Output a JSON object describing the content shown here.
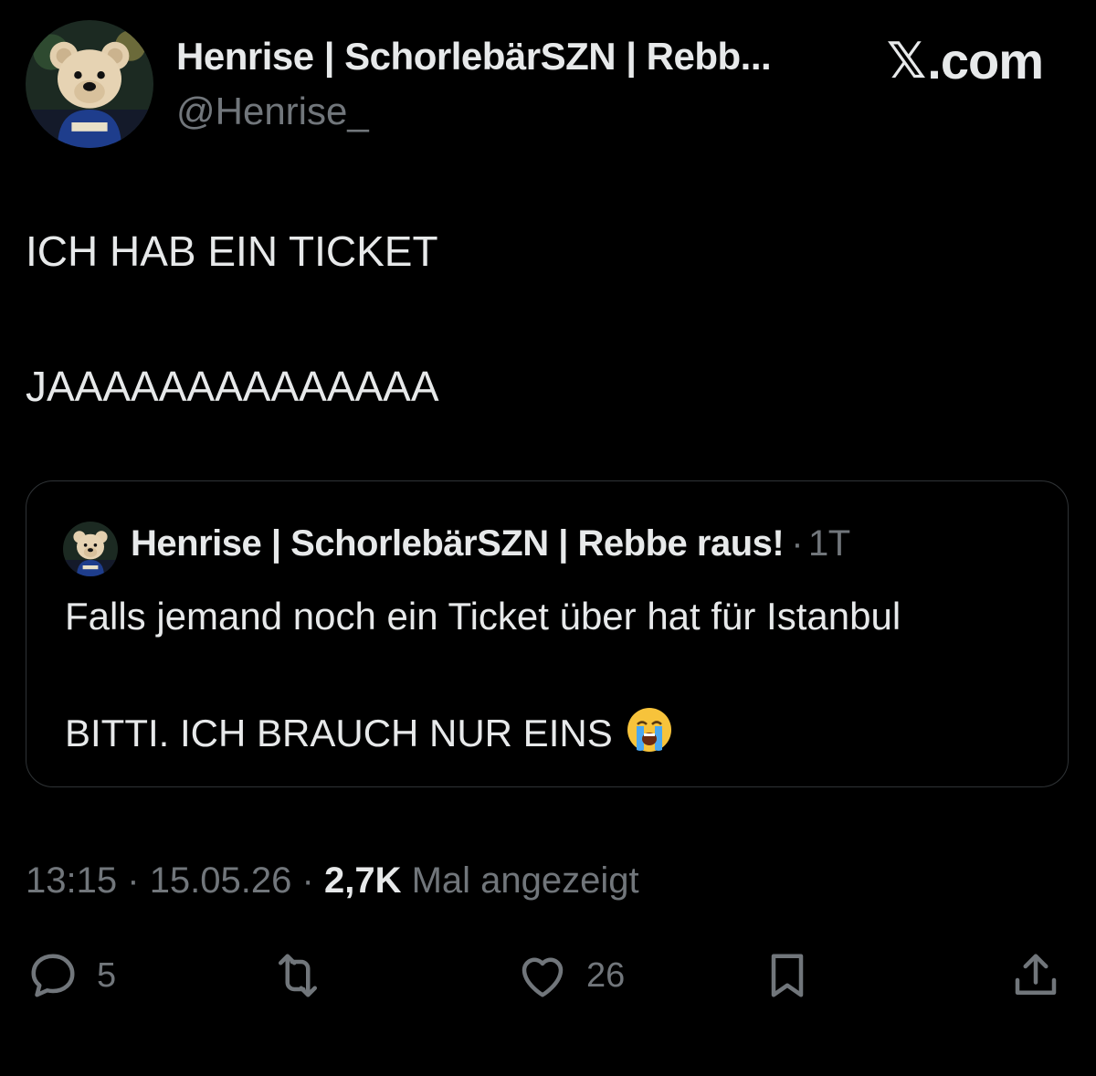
{
  "post": {
    "author_name": "Henrise | SchorlebärSZN | Rebb...",
    "author_handle": "@Henrise_",
    "brand": "X.com",
    "lines": [
      "ICH HAB EIN TICKET",
      "JAAAAAAAAAAAAAA"
    ]
  },
  "quoted": {
    "author_name": "Henrise | SchorlebärSZN | Rebbe raus!",
    "separator": "·",
    "time": "1T",
    "lines": [
      "Falls jemand noch ein Ticket über hat für Istanbul",
      "BITTI. ICH BRAUCH NUR EINS"
    ],
    "emoji": "loudly-crying-face-emoji"
  },
  "meta": {
    "time": "13:15",
    "date": "15.05.26",
    "separator": "·",
    "views_count": "2,7K",
    "views_label": "Mal angezeigt"
  },
  "actions": {
    "reply_count": "5",
    "like_count": "26",
    "icons": [
      "reply-icon",
      "retweet-icon",
      "like-icon",
      "bookmark-icon",
      "share-icon"
    ]
  },
  "colors": {
    "background": "#000000",
    "text": "#e7e9ea",
    "muted": "#71767b",
    "border": "#2f3336"
  }
}
